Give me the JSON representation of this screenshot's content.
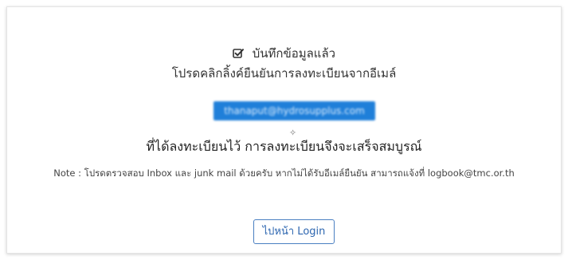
{
  "status": {
    "saved_text": "บันทึกข้อมูลแล้ว",
    "instruction": "โปรดคลิกลิ้งค์ยืนยันการลงทะเบียนจากอีเมล์"
  },
  "email": {
    "value": "thanaput@hydrosupplus.com"
  },
  "confirmation": {
    "text": "ที่ได้ลงทะเบียนไว้ การลงทะเบียนจึงจะเสร็จสมบูรณ์"
  },
  "note": {
    "text": "Note : โปรดตรวจสอบ Inbox และ junk mail ด้วยครับ หากไม่ได้รับอีเมล์ยืนยัน สามารถแจ้งที่ logbook@tmc.or.th"
  },
  "actions": {
    "login_label": "ไปหน้า Login"
  },
  "colors": {
    "accent": "#2d66b0",
    "email_highlight": "#1f7fd9"
  },
  "icons": {
    "saved": "checked-box-icon",
    "pointer": "cursor-sparkle-icon"
  }
}
